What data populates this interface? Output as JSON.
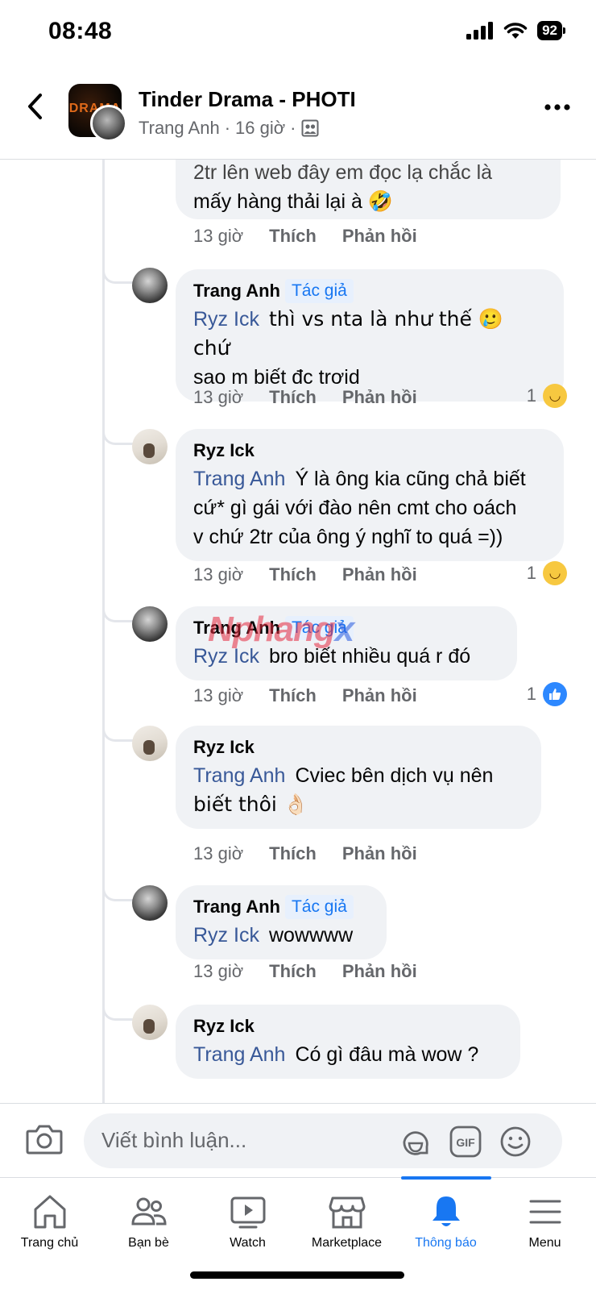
{
  "status": {
    "time": "08:48",
    "battery": "92"
  },
  "header": {
    "title": "Tinder Drama - PHOTI",
    "author": "Trang Anh",
    "separator": "·",
    "time": "16 giờ",
    "group_logo_text": "DRAMA"
  },
  "partial_comment": {
    "line1": "2tr lên web đây em đọc lạ  chắc là",
    "line2": "mấy hàng thải lại à",
    "emoji": "🤣",
    "time": "13 giờ",
    "like": "Thích",
    "reply": "Phản hồi"
  },
  "comments": [
    {
      "name": "Trang Anh",
      "badge": "Tác giả",
      "mention": "Ryz Ick",
      "text": "thì vs nta là như thế 🥲 chứ",
      "text2": "sao m biết đc trơid",
      "time": "13 giờ",
      "like": "Thích",
      "reply": "Phản hồi",
      "reaction_count": "1",
      "reaction": "haha"
    },
    {
      "name": "Ryz Ick",
      "mention": "Trang Anh",
      "text": "Ý là ông kia cũng chả biết",
      "text2": "cứ* gì gái với đào nên cmt cho oách",
      "text3": "v chứ 2tr của ông ý nghĩ to quá =))",
      "time": "13 giờ",
      "like": "Thích",
      "reply": "Phản hồi",
      "reaction_count": "1",
      "reaction": "haha"
    },
    {
      "name": "Trang Anh",
      "badge": "Tác giả",
      "mention": "Ryz Ick",
      "text": "bro biết nhiều quá r đó",
      "time": "13 giờ",
      "like": "Thích",
      "reply": "Phản hồi",
      "reaction_count": "1",
      "reaction": "like"
    },
    {
      "name": "Ryz Ick",
      "mention": "Trang Anh",
      "text": "Cviec bên dịch vụ nên",
      "text2": "biết thôi 👌🏻",
      "time": "13 giờ",
      "like": "Thích",
      "reply": "Phản hồi"
    },
    {
      "name": "Trang Anh",
      "badge": "Tác giả",
      "mention": "Ryz Ick",
      "text": "wowwww",
      "time": "13 giờ",
      "like": "Thích",
      "reply": "Phản hồi"
    },
    {
      "name": "Ryz Ick",
      "mention": "Trang Anh",
      "text": "Có gì đâu mà wow ?"
    }
  ],
  "watermark": {
    "part1": "Nphang",
    "part2": "x"
  },
  "composer": {
    "placeholder": "Viết bình luận..."
  },
  "nav": [
    {
      "label": "Trang chủ",
      "icon": "home-icon"
    },
    {
      "label": "Bạn bè",
      "icon": "friends-icon"
    },
    {
      "label": "Watch",
      "icon": "watch-icon"
    },
    {
      "label": "Marketplace",
      "icon": "marketplace-icon"
    },
    {
      "label": "Thông báo",
      "icon": "bell-icon",
      "active": true
    },
    {
      "label": "Menu",
      "icon": "menu-icon"
    }
  ],
  "colors": {
    "accent": "#1877f2",
    "bubble": "#f0f2f5",
    "mention": "#385898",
    "muted": "#65676b"
  }
}
